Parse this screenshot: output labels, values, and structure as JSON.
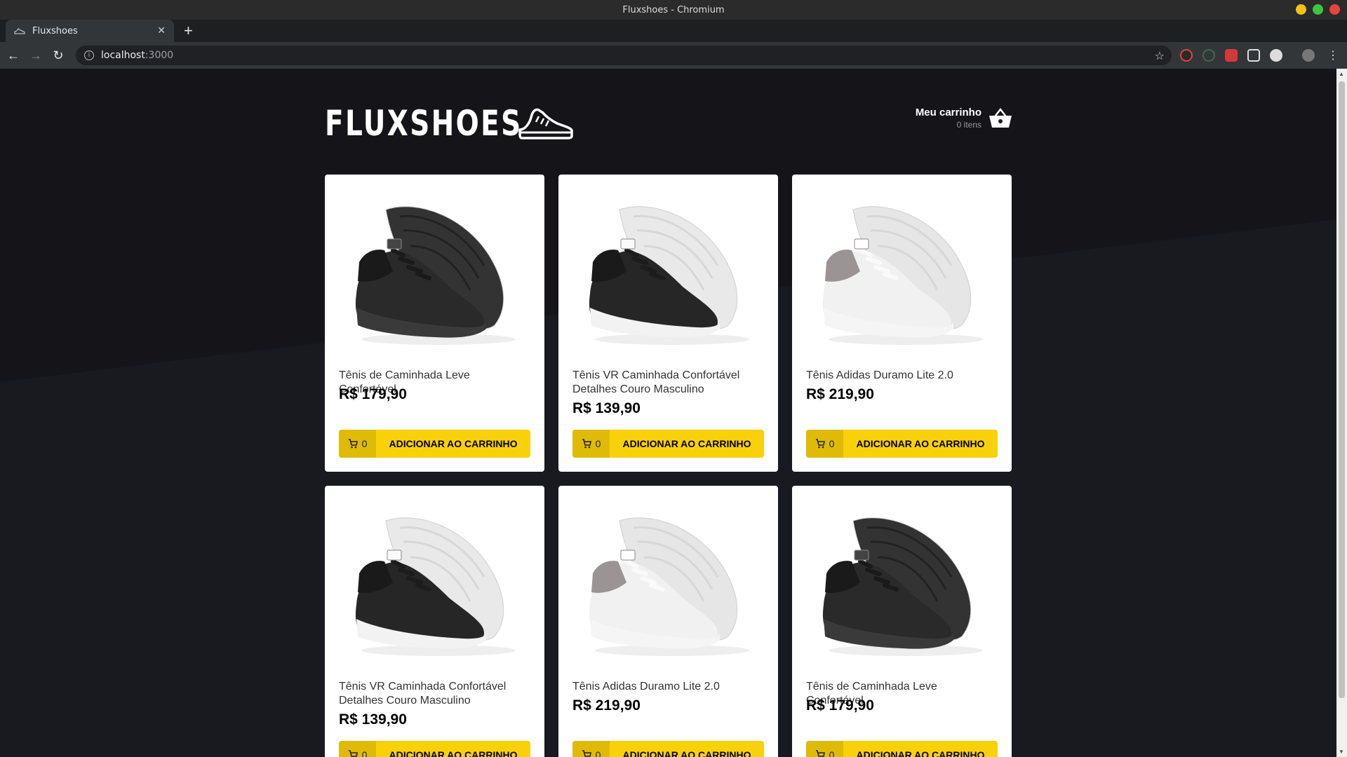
{
  "window": {
    "title": "Fluxshoes - Chromium"
  },
  "tab": {
    "title": "Fluxshoes",
    "favicon": "shoe-icon"
  },
  "omnibox": {
    "host": "localhost",
    "port": ":3000"
  },
  "colors": {
    "background": "#191920",
    "accent": "#f8d10b",
    "accent_dark": "#dfbb08"
  },
  "header": {
    "logo_text": "FLUXSHOES",
    "cart": {
      "title": "Meu carrinho",
      "count_text": "0 itens",
      "icon": "basket-icon"
    }
  },
  "products": [
    {
      "name": "Tênis de Caminhada Leve Confortável",
      "price": "R$ 179,90",
      "shoe": "black",
      "amount": "0",
      "button": "ADICIONAR AO CARRINHO"
    },
    {
      "name": "Tênis VR Caminhada Confortável Detalhes Couro Masculino",
      "price": "R$ 139,90",
      "shoe": "black-white",
      "amount": "0",
      "button": "ADICIONAR AO CARRINHO"
    },
    {
      "name": "Tênis Adidas Duramo Lite 2.0",
      "price": "R$ 219,90",
      "shoe": "white-grey",
      "amount": "0",
      "button": "ADICIONAR AO CARRINHO"
    },
    {
      "name": "Tênis VR Caminhada Confortável Detalhes Couro Masculino",
      "price": "R$ 139,90",
      "shoe": "black-white",
      "amount": "0",
      "button": "ADICIONAR AO CARRINHO"
    },
    {
      "name": "Tênis Adidas Duramo Lite 2.0",
      "price": "R$ 219,90",
      "shoe": "white-grey",
      "amount": "0",
      "button": "ADICIONAR AO CARRINHO"
    },
    {
      "name": "Tênis de Caminhada Leve Confortável",
      "price": "R$ 179,90",
      "shoe": "black",
      "amount": "0",
      "button": "ADICIONAR AO CARRINHO"
    }
  ]
}
